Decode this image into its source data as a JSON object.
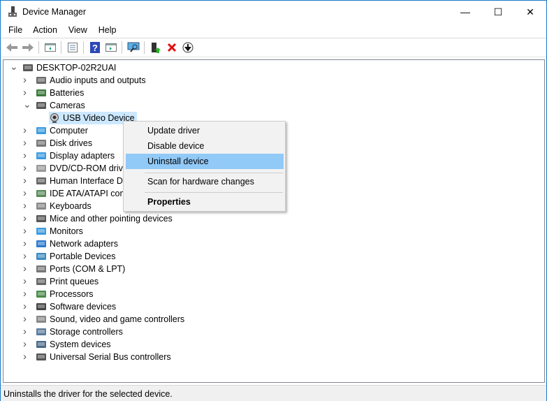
{
  "window": {
    "title": "Device Manager",
    "minimize": "—",
    "maximize": "☐",
    "close": "✕",
    "border_color": "#1979ca"
  },
  "menubar": [
    "File",
    "Action",
    "View",
    "Help"
  ],
  "toolbar": [
    "back-icon",
    "forward-icon",
    "show-hide-console-tree-icon",
    "properties-icon",
    "help-icon",
    "action-pane-icon",
    "scan-hardware-icon",
    "update-driver-icon",
    "uninstall-icon",
    "disable-icon"
  ],
  "tree": {
    "root": "DESKTOP-02R2UAI",
    "categories": [
      {
        "label": "Audio inputs and outputs",
        "expanded": false
      },
      {
        "label": "Batteries",
        "expanded": false
      },
      {
        "label": "Cameras",
        "expanded": true,
        "children": [
          "USB Video Device"
        ]
      },
      {
        "label": "Computer"
      },
      {
        "label": "Disk drives"
      },
      {
        "label": "Display adapters"
      },
      {
        "label": "DVD/CD-ROM drives"
      },
      {
        "label": "Human Interface Devices"
      },
      {
        "label": "IDE ATA/ATAPI controllers"
      },
      {
        "label": "Keyboards"
      },
      {
        "label": "Mice and other pointing devices"
      },
      {
        "label": "Monitors"
      },
      {
        "label": "Network adapters"
      },
      {
        "label": "Portable Devices"
      },
      {
        "label": "Ports (COM & LPT)"
      },
      {
        "label": "Print queues"
      },
      {
        "label": "Processors"
      },
      {
        "label": "Software devices"
      },
      {
        "label": "Sound, video and game controllers"
      },
      {
        "label": "Storage controllers"
      },
      {
        "label": "System devices"
      },
      {
        "label": "Universal Serial Bus controllers"
      }
    ]
  },
  "context_menu": {
    "items": [
      "Update driver",
      "Disable device",
      "Uninstall device",
      "Scan for hardware changes",
      "Properties"
    ],
    "highlighted": "Uninstall device"
  },
  "status": "Uninstalls the driver for the selected device."
}
